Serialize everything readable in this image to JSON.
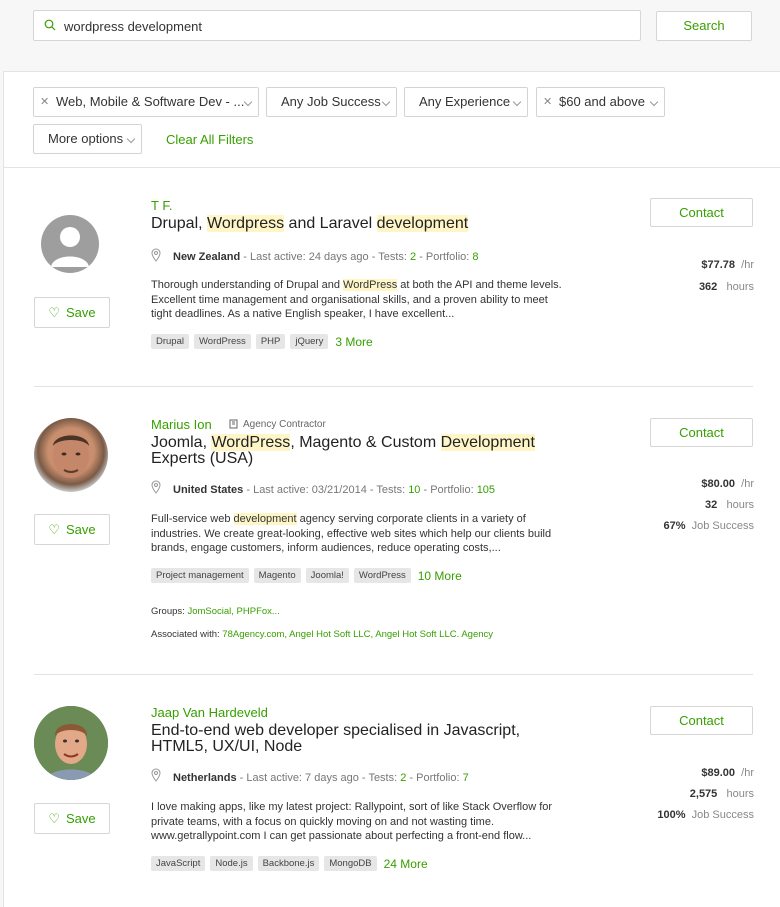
{
  "search": {
    "value": "wordpress development",
    "button": "Search"
  },
  "filters": {
    "category": "Web, Mobile & Software Dev - ...",
    "job_success": "Any Job Success",
    "experience": "Any Experience",
    "rate": "$60 and above",
    "more_options": "More options",
    "clear_all": "Clear All Filters"
  },
  "freelancers": [
    {
      "name": "T F.",
      "title_parts": [
        "Drupal, ",
        "Wordpress",
        " and Laravel ",
        "development"
      ],
      "location": "New Zealand",
      "last_active": " - Last active: 24 days ago - Tests: ",
      "tests": "2",
      "portfolio_label": " - Portfolio: ",
      "portfolio": "8",
      "desc_parts": [
        "Thorough understanding of Drupal and ",
        "WordPress",
        " at both the API and theme levels. Excellent time management and organisational skills, and a proven ability to meet tight deadlines. As a native English speaker, I have excellent..."
      ],
      "tags": [
        "Drupal",
        "WordPress",
        "PHP",
        "jQuery"
      ],
      "more": "3 More",
      "rate": "$77.78",
      "rate_unit": "/hr",
      "hours": "362",
      "hours_unit": "hours",
      "contact": "Contact",
      "save": "Save"
    },
    {
      "name": "Marius Ion",
      "agency_label": "Agency Contractor",
      "title_parts": [
        "Joomla, ",
        "WordPress",
        ", Magento & Custom ",
        "Development",
        " Experts (USA)"
      ],
      "location": "United States",
      "last_active": " - Last active: 03/21/2014 - Tests: ",
      "tests": "10",
      "portfolio_label": " - Portfolio: ",
      "portfolio": "105",
      "desc_parts": [
        "Full-service web ",
        "development",
        " agency serving corporate clients in a variety of industries. We create great-looking, effective web sites which help our clients build brands, engage customers, inform audiences, reduce operating costs,..."
      ],
      "tags": [
        "Project management",
        "Magento",
        "Joomla!",
        "WordPress"
      ],
      "more": "10 More",
      "rate": "$80.00",
      "rate_unit": "/hr",
      "hours": "32",
      "hours_unit": "hours",
      "job_success": "67%",
      "job_success_label": "Job Success",
      "groups_label": "Groups: ",
      "groups": "JomSocial, PHPFox...",
      "assoc_label": "Associated with: ",
      "assoc": "78Agency.com, Angel Hot Soft LLC, Angel Hot Soft LLC. Agency",
      "contact": "Contact",
      "save": "Save"
    },
    {
      "name": "Jaap Van Hardeveld",
      "title_parts": [
        "End-to-end web developer specialised in Javascript, HTML5, UX/UI, Node"
      ],
      "location": "Netherlands",
      "last_active": " - Last active: 7 days ago - Tests: ",
      "tests": "2",
      "portfolio_label": " - Portfolio: ",
      "portfolio": "7",
      "desc_parts": [
        "I love making apps, like my latest project: Rallypoint, sort of like Stack Overflow for private teams, with a focus on quickly moving on and not wasting time. www.getrallypoint.com I can get passionate about perfecting a front-end flow..."
      ],
      "tags": [
        "JavaScript",
        "Node.js",
        "Backbone.js",
        "MongoDB"
      ],
      "more": "24 More",
      "rate": "$89.00",
      "rate_unit": "/hr",
      "hours": "2,575",
      "hours_unit": "hours",
      "job_success": "100%",
      "job_success_label": "Job Success",
      "contact": "Contact",
      "save": "Save"
    }
  ],
  "colors": {
    "accent": "#37a000",
    "highlight": "#fff6c8"
  }
}
